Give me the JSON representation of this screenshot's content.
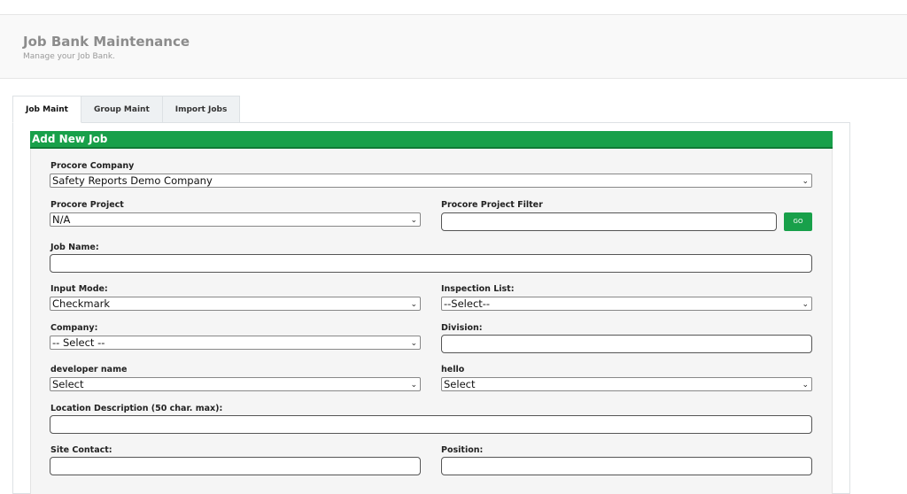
{
  "header": {
    "title": "Job Bank Maintenance",
    "subtitle": "Manage your Job Bank."
  },
  "tabs": [
    {
      "label": "Job Maint",
      "active": true
    },
    {
      "label": "Group Maint",
      "active": false
    },
    {
      "label": "Import Jobs",
      "active": false
    }
  ],
  "form": {
    "header": "Add New Job",
    "procore_company": {
      "label": "Procore Company",
      "value": "Safety Reports Demo Company"
    },
    "procore_project": {
      "label": "Procore Project",
      "value": "N/A"
    },
    "procore_project_filter": {
      "label": "Procore Project Filter",
      "value": "",
      "go_label": "GO"
    },
    "job_name": {
      "label": "Job Name:",
      "value": ""
    },
    "input_mode": {
      "label": "Input Mode:",
      "value": "Checkmark"
    },
    "inspection_list": {
      "label": "Inspection List:",
      "value": "--Select--"
    },
    "company": {
      "label": "Company:",
      "value": "-- Select --"
    },
    "division": {
      "label": "Division:",
      "value": ""
    },
    "developer_name": {
      "label": "developer name",
      "value": "Select"
    },
    "hello": {
      "label": "hello",
      "value": "Select"
    },
    "location_description": {
      "label": "Location Description (50 char. max):",
      "value": ""
    },
    "site_contact": {
      "label": "Site Contact:",
      "value": ""
    },
    "position": {
      "label": "Position:",
      "value": ""
    }
  },
  "colors": {
    "accent": "#18a04a"
  }
}
